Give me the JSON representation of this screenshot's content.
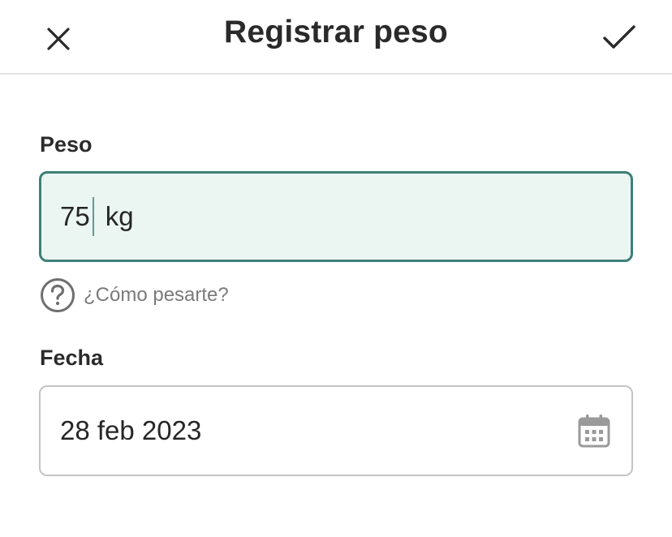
{
  "header": {
    "title": "Registrar peso",
    "close_icon": "close-icon",
    "confirm_icon": "checkmark-icon"
  },
  "weight": {
    "label": "Peso",
    "value": "75",
    "unit": "kg",
    "help_icon": "question-circle-icon",
    "help_text": "¿Cómo pesarte?"
  },
  "date": {
    "label": "Fecha",
    "value": "28 feb 2023",
    "icon": "calendar-icon"
  },
  "colors": {
    "accent": "#3d8077",
    "field_active_bg": "#ebf5f2",
    "help_text": "#7a7a7a"
  }
}
